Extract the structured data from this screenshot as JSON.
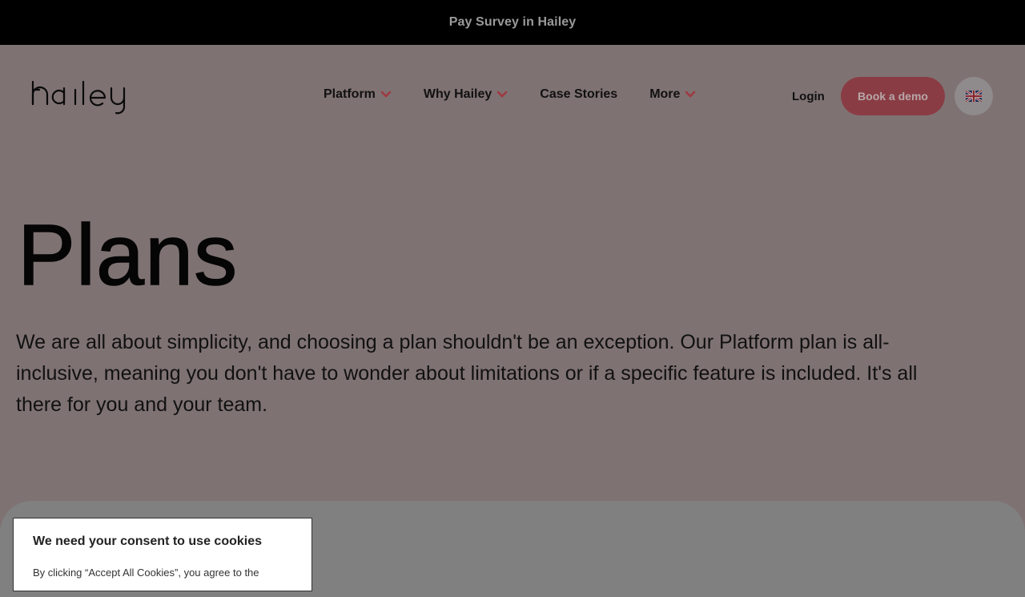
{
  "announcement": {
    "text": "Pay Survey in Hailey"
  },
  "header": {
    "logo_text": "hailey",
    "nav": [
      {
        "label": "Platform",
        "has_dropdown": true
      },
      {
        "label": "Why Hailey",
        "has_dropdown": true
      },
      {
        "label": "Case Stories",
        "has_dropdown": false
      },
      {
        "label": "More",
        "has_dropdown": true
      }
    ],
    "login_label": "Login",
    "demo_label": "Book a demo",
    "language_icon": "uk-flag-icon"
  },
  "hero": {
    "title": "Plans",
    "description": "We are all about simplicity, and choosing a plan shouldn't be an exception. Our Platform plan is all-inclusive, meaning you don't have to wonder about limitations or if a specific feature is included. It's all there for you and your team."
  },
  "cookie_banner": {
    "title": "We need your consent to use cookies",
    "text": "By clicking “Accept All Cookies”, you agree to the"
  },
  "colors": {
    "overlay_bg": "#7f7273",
    "accent": "#8a3c44",
    "chevron": "#9e3a42"
  }
}
